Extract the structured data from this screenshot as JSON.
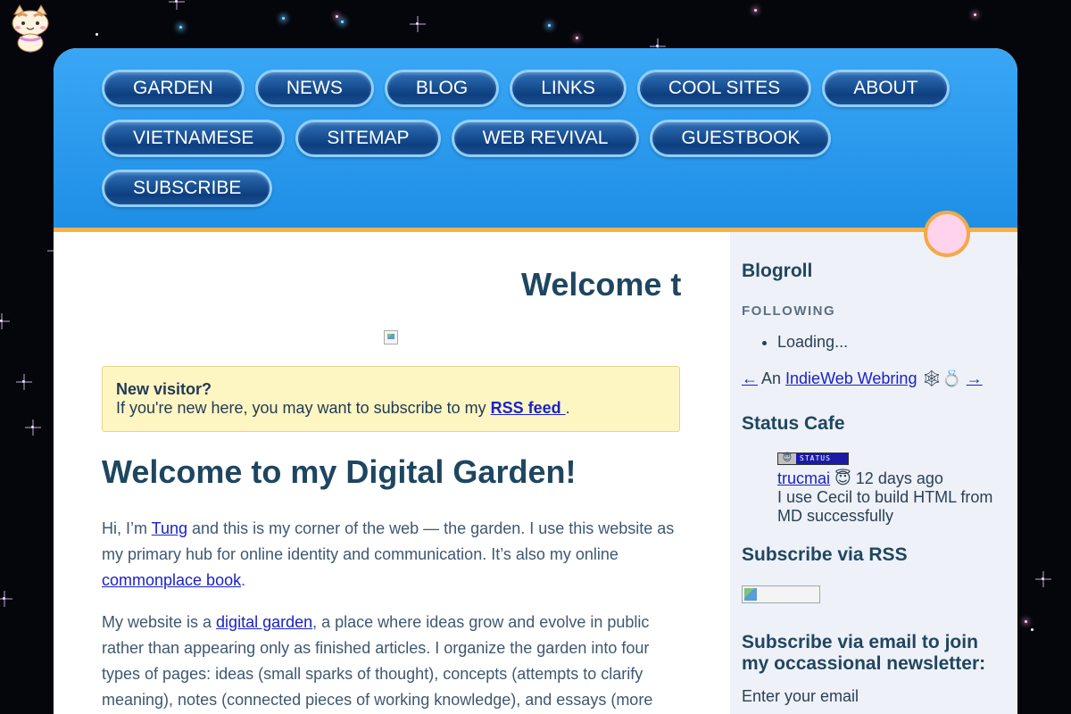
{
  "nav": {
    "row1": [
      "GARDEN",
      "NEWS",
      "BLOG",
      "LINKS",
      "COOL SITES",
      "ABOUT"
    ],
    "row2": [
      "VIETNAMESE",
      "SITEMAP",
      "WEB REVIVAL",
      "GUESTBOOK"
    ],
    "row3": [
      "SUBSCRIBE"
    ]
  },
  "main": {
    "title": "Welcome t",
    "notice": {
      "heading": "New visitor?",
      "text": "If you're new here, you may want to subscribe to my ",
      "link": "RSS feed ",
      "end": "."
    },
    "heading": "Welcome to my Digital Garden!",
    "p1": {
      "a": "Hi, I’m ",
      "link1": "Tung",
      "b": " and this is my corner of the web — the garden. I use this website as my primary hub for online identity and communication. It’s also my online ",
      "link2": "commonplace book",
      "c": "."
    },
    "p2": {
      "a": "My website is a ",
      "link1": "digital garden",
      "b": ", a place where ideas grow and evolve in public rather than appearing only as finished articles. I organize the garden into four types of pages: ideas (small sparks of thought), concepts (attempts to clarify meaning), notes (connected pieces of working knowledge), and essays (more"
    }
  },
  "sidebar": {
    "blogroll_title": "Blogroll",
    "following_label": "FOLLOWING",
    "loading": "Loading...",
    "webring": {
      "prev": "←",
      "pre_text": " An ",
      "link": "IndieWeb Webring",
      "emoji": " 🕸💍 ",
      "next": "→"
    },
    "status_title": "Status Cafe",
    "status": {
      "badge_text": "STATUS",
      "badge_face": "😇",
      "user": "trucmai",
      "emoji": " 😇 ",
      "time": "12 days ago",
      "message": "I use Cecil to build HTML from MD successfully"
    },
    "rss_title": "Subscribe via RSS",
    "email_title": "Subscribe via email to join my occassional newsletter:",
    "email_label": "Enter your email"
  },
  "colors": {
    "header": "#2196ee",
    "nav_button": "#0d3f80",
    "accent_border": "#f4b249",
    "link": "#1a22c8",
    "notice_bg": "#fdf5c2"
  }
}
